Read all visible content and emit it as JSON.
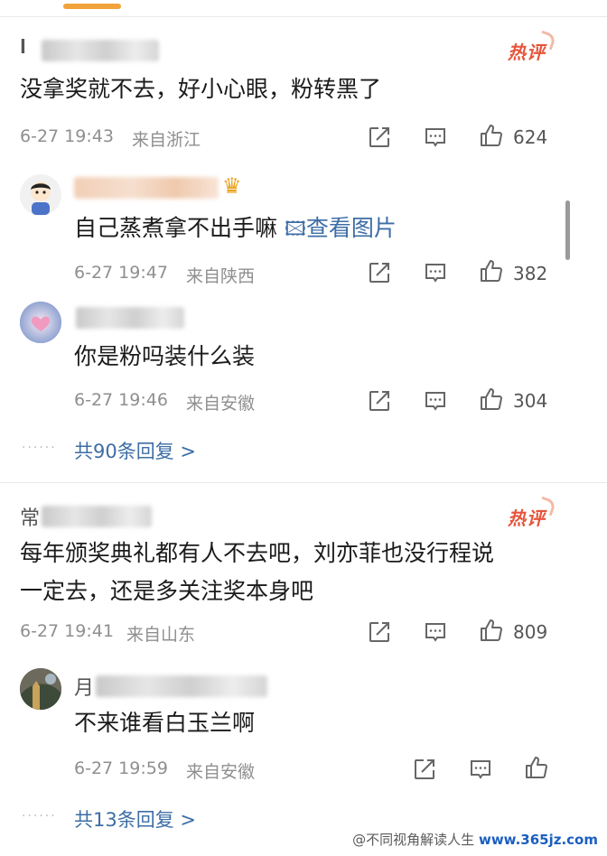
{
  "comments": [
    {
      "name_initial": "𝐈",
      "hot_label": "热评",
      "text": "没拿奖就不去，好小心眼，粉转黑了",
      "time": "6-27 19:43",
      "location": "来自浙江",
      "likes": "624",
      "replies": [
        {
          "text": "自己蒸煮拿不出手嘛",
          "image_link": "查看图片",
          "time": "6-27 19:47",
          "location": "来自陕西",
          "likes": "382"
        },
        {
          "text": "你是粉吗装什么装",
          "time": "6-27 19:46",
          "location": "来自安徽",
          "likes": "304"
        }
      ],
      "reply_count_label": "共90条回复 >"
    },
    {
      "name_initial": "常",
      "hot_label": "热评",
      "text_line1": "每年颁奖典礼都有人不去吧，刘亦菲也没行程说",
      "text_line2": "一定去，还是多关注奖本身吧",
      "time": "6-27 19:41",
      "location": "来自山东",
      "likes": "809",
      "replies": [
        {
          "name_initial": "月",
          "text": "不来谁看白玉兰啊",
          "time": "6-27 19:59",
          "location": "来自安徽"
        }
      ],
      "reply_count_label": "共13条回复 >"
    }
  ],
  "more_dots": "······",
  "watermark": {
    "text": "@不同视角解读人生",
    "site": "www.365jz.com"
  },
  "colors": {
    "hot": "#e6543a",
    "link": "#3d6ea5",
    "tab_indicator": "#f2a33c"
  }
}
